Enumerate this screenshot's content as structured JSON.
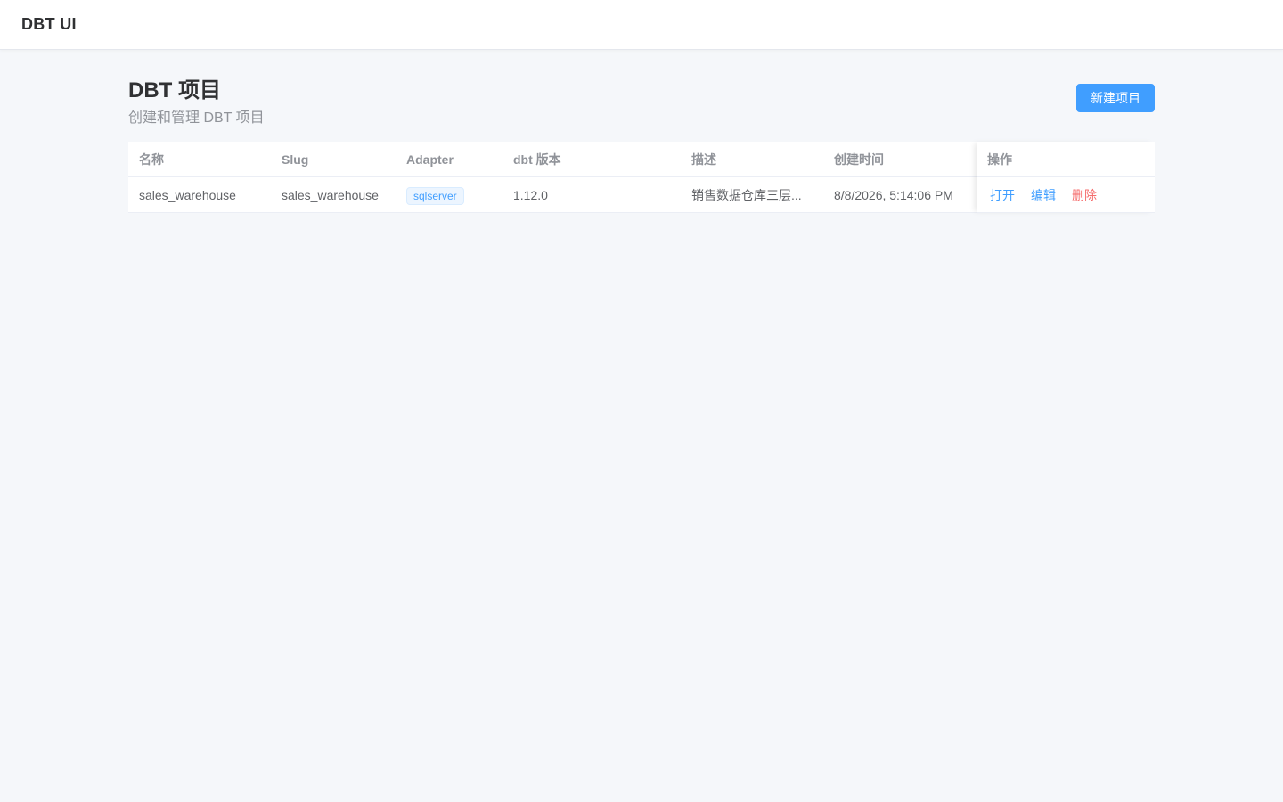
{
  "app": {
    "title": "DBT UI"
  },
  "page": {
    "title": "DBT 项目",
    "subtitle": "创建和管理 DBT 项目",
    "new_button_label": "新建项目"
  },
  "table": {
    "columns": {
      "name": "名称",
      "slug": "Slug",
      "adapter": "Adapter",
      "version": "dbt 版本",
      "description": "描述",
      "created": "创建时间",
      "actions": "操作"
    },
    "rows": [
      {
        "name": "sales_warehouse",
        "slug": "sales_warehouse",
        "adapter": "sqlserver",
        "version": "1.12.0",
        "description": "销售数据仓库三层...",
        "created": "8/8/2026, 5:14:06 PM",
        "actions": {
          "open": "打开",
          "edit": "编辑",
          "delete": "删除"
        }
      }
    ]
  },
  "colors": {
    "primary": "#409eff",
    "danger": "#f56c6c",
    "background": "#f5f7fa"
  }
}
